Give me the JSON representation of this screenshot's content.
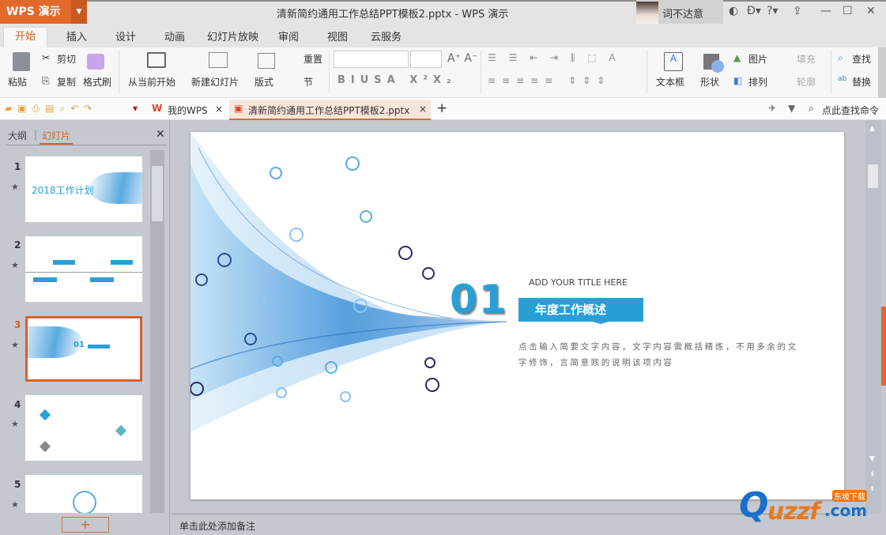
{
  "app": {
    "name": "WPS 演示",
    "window_title": "清新简约通用工作总结PPT模板2.pptx - WPS 演示",
    "user": "词不达意"
  },
  "menu_tabs": [
    "开始",
    "插入",
    "设计",
    "动画",
    "幻灯片放映",
    "审阅",
    "视图",
    "云服务"
  ],
  "ribbon": {
    "paste": "粘贴",
    "cut": "剪切",
    "copy": "复制",
    "format_painter": "格式刷",
    "from_current": "从当前开始",
    "new_slide": "新建幻灯片",
    "layout": "版式",
    "reset": "重置",
    "section": "节",
    "textbox": "文本框",
    "shape": "形状",
    "picture": "图片",
    "fill": "填充",
    "arrange": "排列",
    "outline": "轮廓",
    "find": "查找",
    "replace": "替换"
  },
  "doc_tabs": {
    "home": "我的WPS",
    "doc": "清新简约通用工作总结PPT模板2.pptx"
  },
  "command_search": "点此查找命令",
  "panel": {
    "outline_tab": "大纲",
    "slides_tab": "幻灯片",
    "slides": [
      {
        "n": "1",
        "title": "2018工作计划"
      },
      {
        "n": "2"
      },
      {
        "n": "3",
        "selected": true
      },
      {
        "n": "4"
      },
      {
        "n": "5"
      }
    ]
  },
  "slide": {
    "number": "01",
    "subtitle": "ADD YOUR TITLE HERE",
    "title": "年度工作概述",
    "body": "点击输入简要文字内容，文字内容需概括精炼，不用多余的文字修饰，言简意赅的说明该项内容"
  },
  "notes_placeholder": "单击此处添加备注",
  "watermark": "uzzf.com 东坡下载",
  "colors": {
    "accent": "#e2692b",
    "slide_blue": "#2a9fd6"
  }
}
